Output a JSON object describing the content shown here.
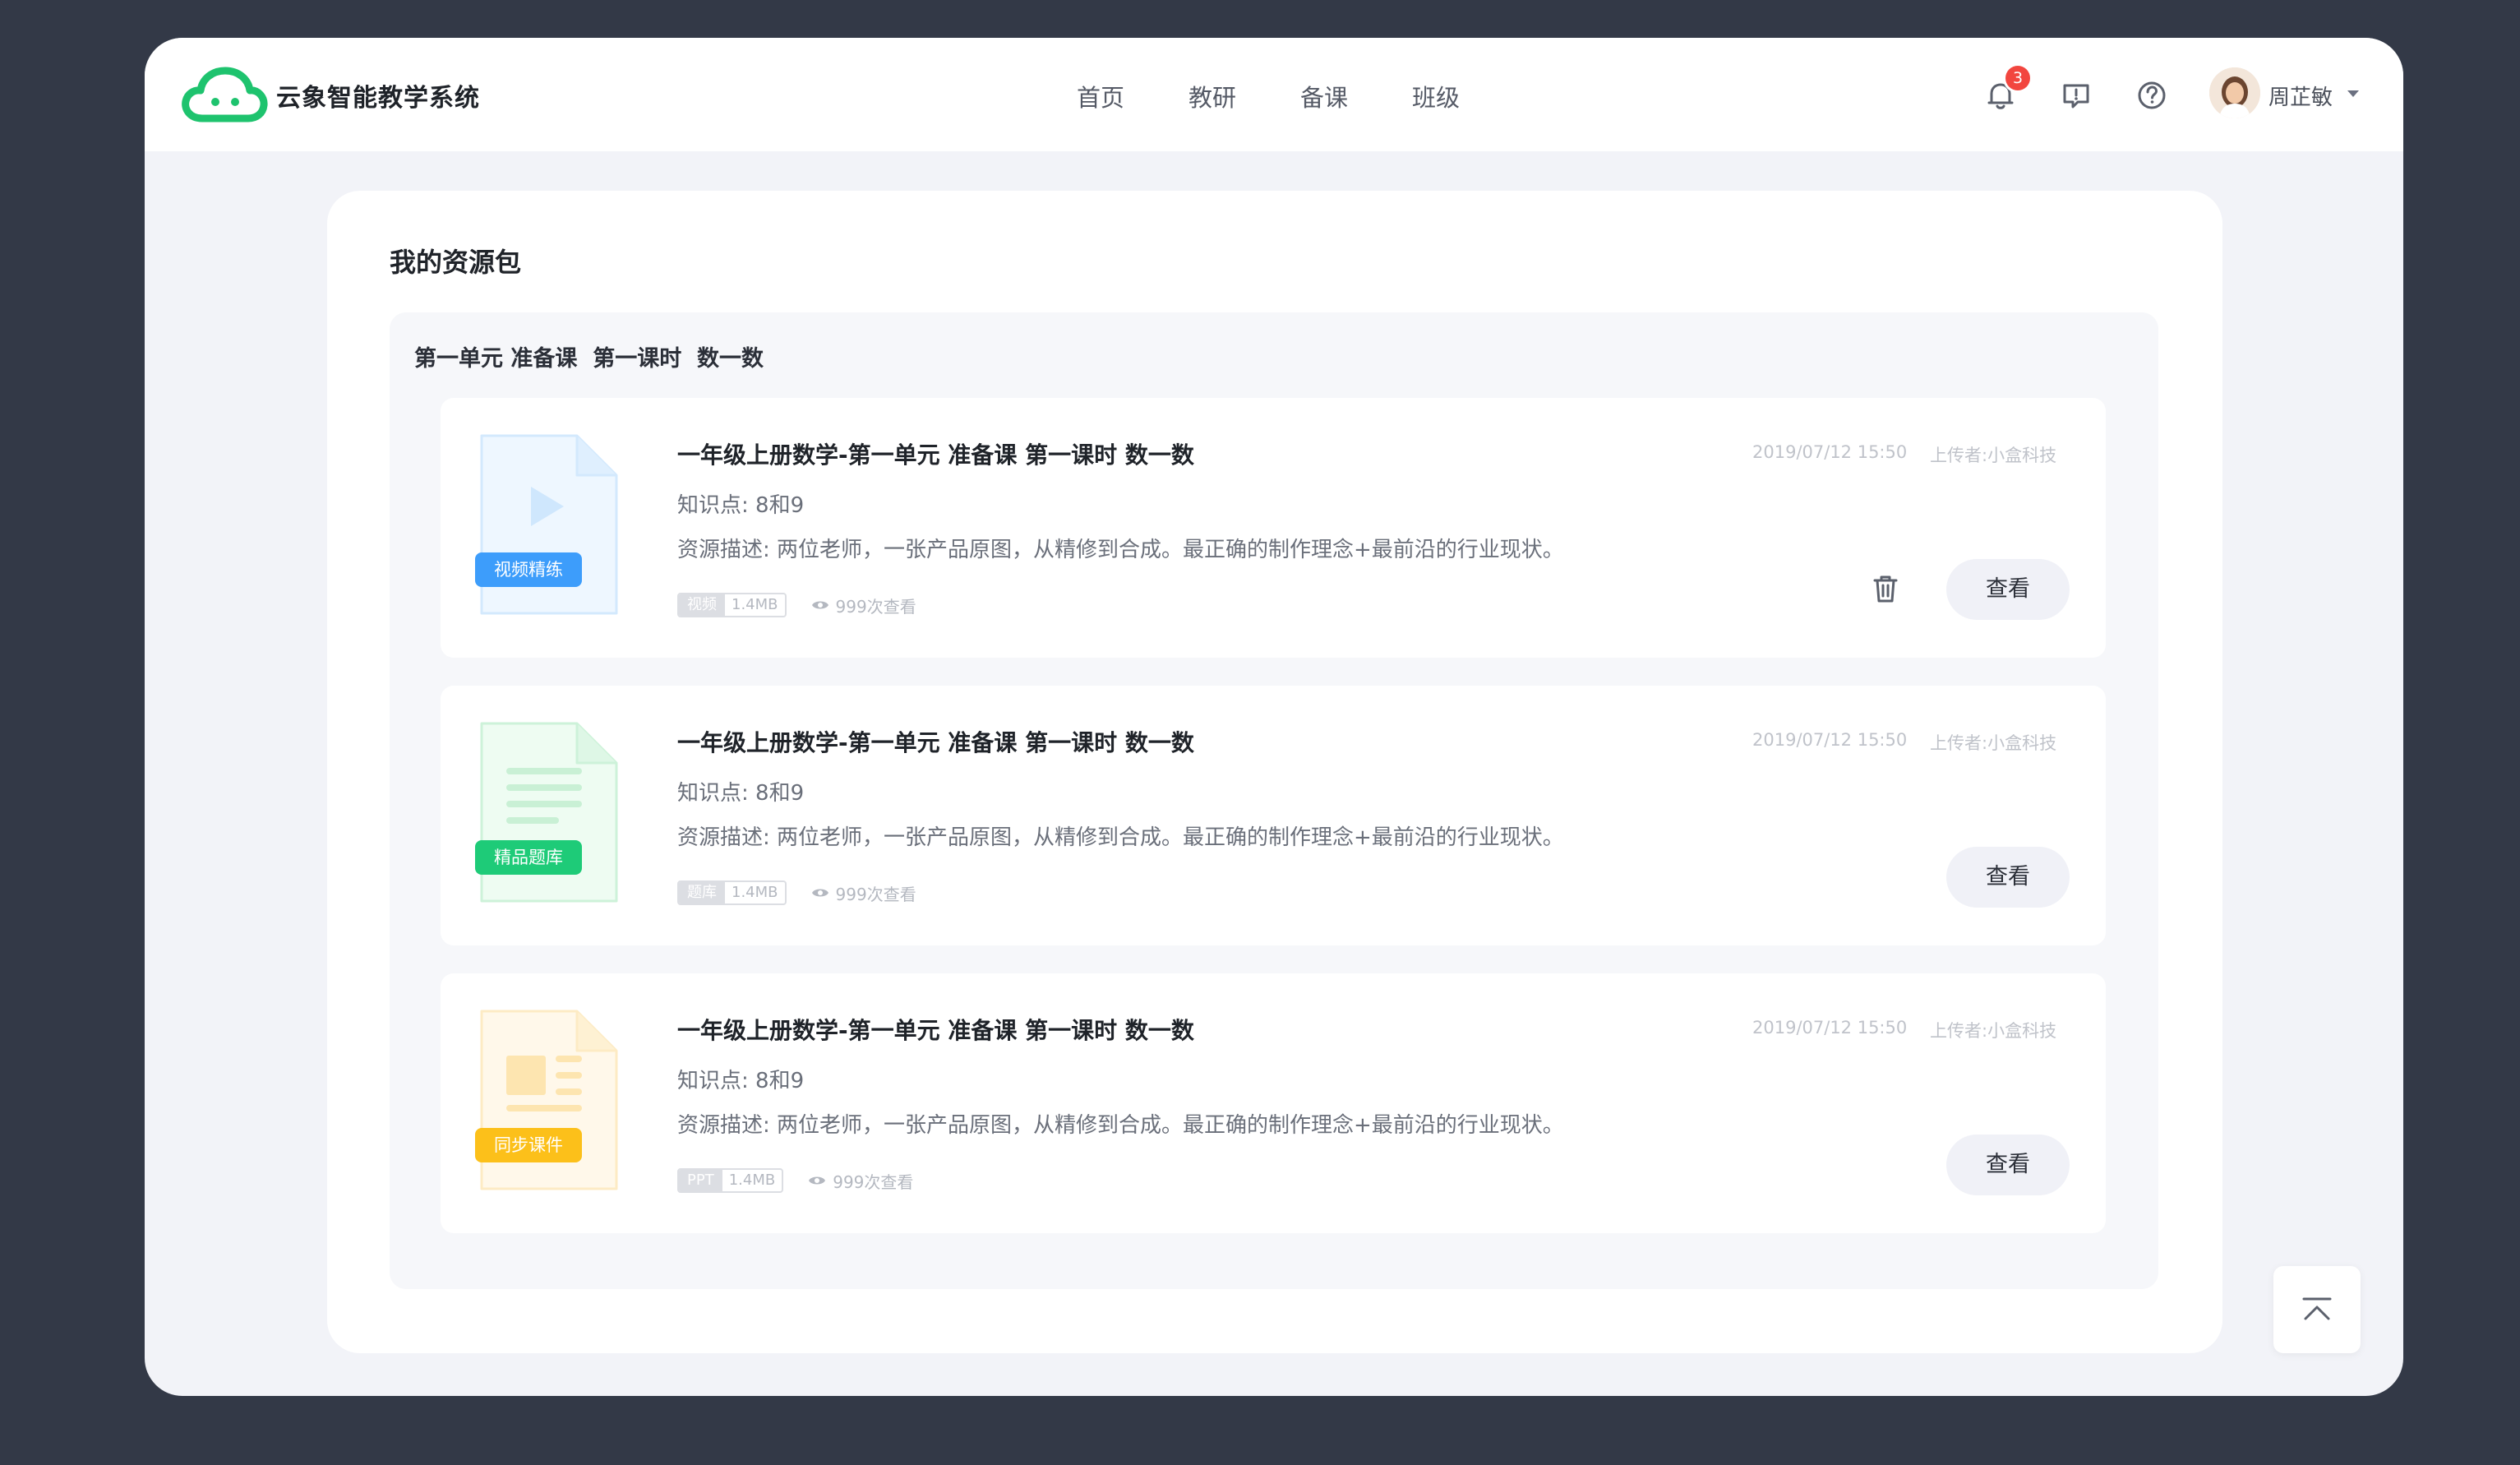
{
  "app": {
    "title": "云象智能教学系统"
  },
  "nav": {
    "items": [
      "首页",
      "教研",
      "备课",
      "班级"
    ]
  },
  "header": {
    "notification_count": "3",
    "user_name": "周芷敏"
  },
  "page": {
    "title": "我的资源包",
    "group_title": "第一单元 准备课  第一课时  数一数"
  },
  "resources": [
    {
      "title": "一年级上册数学-第一单元 准备课 第一课时 数一数",
      "knowledge": "知识点: 8和9",
      "description": "资源描述: 两位老师，一张产品原图，从精修到合成。最正确的制作理念+最前沿的行业现状。",
      "file_type": "视频",
      "file_size": "1.4MB",
      "views": "999次查看",
      "date": "2019/07/12 15:50",
      "uploader": "上传者:小盒科技",
      "badge": "视频精练",
      "badge_color": "#3d9dfb",
      "thumb_type": "video",
      "view_label": "查看",
      "has_delete": true
    },
    {
      "title": "一年级上册数学-第一单元 准备课 第一课时 数一数",
      "knowledge": "知识点: 8和9",
      "description": "资源描述: 两位老师，一张产品原图，从精修到合成。最正确的制作理念+最前沿的行业现状。",
      "file_type": "题库",
      "file_size": "1.4MB",
      "views": "999次查看",
      "date": "2019/07/12 15:50",
      "uploader": "上传者:小盒科技",
      "badge": "精品题库",
      "badge_color": "#1ecb78",
      "thumb_type": "document",
      "view_label": "查看",
      "has_delete": false
    },
    {
      "title": "一年级上册数学-第一单元 准备课 第一课时 数一数",
      "knowledge": "知识点: 8和9",
      "description": "资源描述: 两位老师，一张产品原图，从精修到合成。最正确的制作理念+最前沿的行业现状。",
      "file_type": "PPT",
      "file_size": "1.4MB",
      "views": "999次查看",
      "date": "2019/07/12 15:50",
      "uploader": "上传者:小盒科技",
      "badge": "同步课件",
      "badge_color": "#fcc01a",
      "thumb_type": "ppt",
      "view_label": "查看",
      "has_delete": false
    }
  ],
  "colors": {
    "brand_green": "#1ec36e",
    "badge_red": "#f2463f"
  }
}
